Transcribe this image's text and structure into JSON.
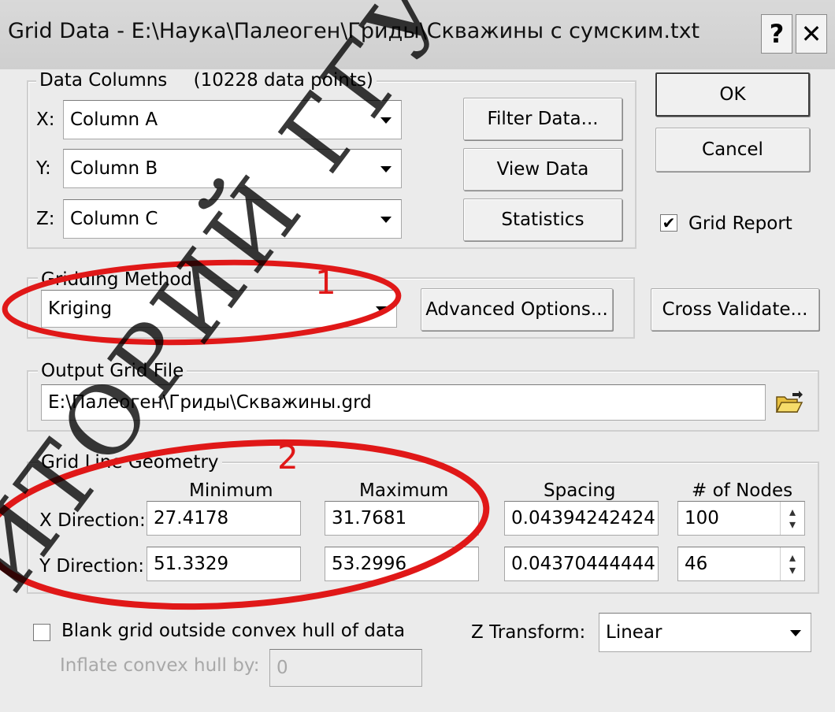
{
  "window": {
    "title": "Grid Data - E:\\Наука\\Палеоген\\Гриды\\Скважины с сумским.txt",
    "help_label": "?",
    "close_label": "✕"
  },
  "data_columns": {
    "group_label": "Data Columns",
    "points_label": "(10228 data points)",
    "x_label": "X:",
    "x_value": "Column A",
    "y_label": "Y:",
    "y_value": "Column B",
    "z_label": "Z:",
    "z_value": "Column C",
    "filter_button": "Filter Data...",
    "view_button": "View Data",
    "stats_button": "Statistics"
  },
  "actions": {
    "ok": "OK",
    "cancel": "Cancel",
    "grid_report_label": "Grid Report",
    "grid_report_checked": true
  },
  "gridding": {
    "group_label": "Gridding Method",
    "method": "Kriging",
    "advanced_button": "Advanced Options...",
    "cross_validate_button": "Cross Validate..."
  },
  "output": {
    "group_label": "Output Grid File",
    "path": "E:\\Палеоген\\Гриды\\Скважины.grd",
    "folder_icon": "open-folder-icon"
  },
  "geometry": {
    "group_label": "Grid Line Geometry",
    "headers": [
      "Minimum",
      "Maximum",
      "Spacing",
      "# of Nodes"
    ],
    "rows": [
      {
        "label": "X Direction:",
        "min": "27.4178",
        "max": "31.7681",
        "spacing": "0.04394242424",
        "nodes": "100"
      },
      {
        "label": "Y Direction:",
        "min": "51.3329",
        "max": "53.2996",
        "spacing": "0.04370444444",
        "nodes": "46"
      }
    ]
  },
  "bottom": {
    "blank_label": "Blank grid outside convex hull of data",
    "blank_checked": false,
    "z_transform_label": "Z Transform:",
    "z_transform_value": "Linear",
    "inflate_label": "Inflate convex hull by:",
    "inflate_value": "0"
  },
  "annotations": {
    "mark1": "1",
    "mark2": "2",
    "annotation_color": "#e01818"
  },
  "watermark": {
    "text": "ЗИТОРИЙ ГГУ ИМЕНИ Ф. СК"
  },
  "colors": {
    "dialog_bg": "#ebebeb",
    "titlebar_bg": "#d4d4d4"
  }
}
